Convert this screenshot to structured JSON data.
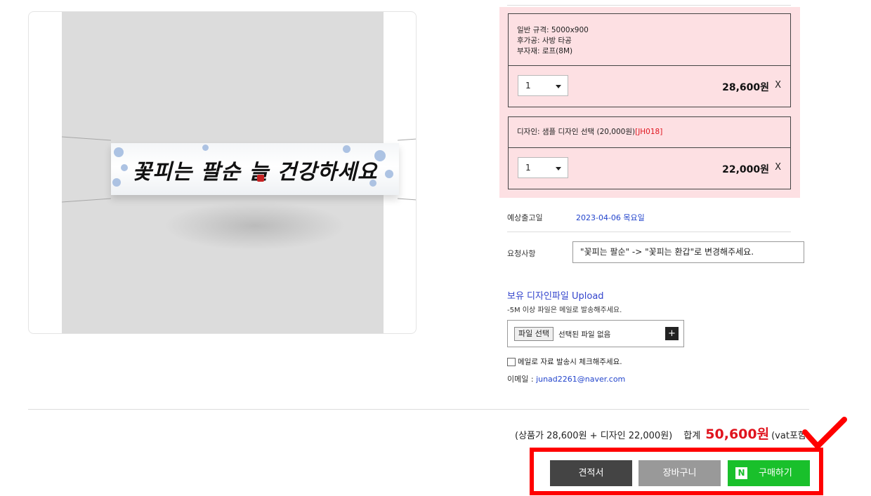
{
  "product_image": {
    "banner_text": "꽃피는 팔순 늘 건강하세요"
  },
  "options": [
    {
      "lines": [
        "일반 규격: 5000x900",
        "후가공: 사방 타공",
        "부자재: 로프(8M)"
      ],
      "quantity": "1",
      "price": "28,600원",
      "remove": "X"
    },
    {
      "description": "디자인: 샘플 디자인 선택 (20,000원)",
      "code": "[JH018]",
      "quantity": "1",
      "price": "22,000원",
      "remove": "X"
    }
  ],
  "shipping": {
    "label": "예상출고일",
    "date": "2023-04-06 목요일"
  },
  "request": {
    "label": "요청사항",
    "value": "\"꽃피는 팔순\" -> \"꽃피는 환갑\"로 변경해주세요."
  },
  "upload": {
    "title": "보유 디자인파일 Upload",
    "note": "-5M 이상 파일은 메일로 발송해주세요.",
    "file_button": "파일 선택",
    "file_status": "선택된 파일 없음",
    "plus": "+"
  },
  "email_check": {
    "label": "메일로 자료 발송시 체크해주세요.",
    "checked": false
  },
  "email": {
    "label": "이메일 : ",
    "value": "junad2261@naver.com"
  },
  "summary": {
    "breakdown": "(상품가 28,600원 + 디자인 22,000원)",
    "total_label": "합계",
    "total_amount": "50,600원",
    "vat": "(vat포함"
  },
  "buttons": {
    "quote": "견적서",
    "cart": "장바구니",
    "buy_logo": "N",
    "buy": "구매하기"
  },
  "colors": {
    "highlight": "#ff0000",
    "total": "#e0141e",
    "buy": "#19c02b",
    "pink": "#fde0e3"
  }
}
